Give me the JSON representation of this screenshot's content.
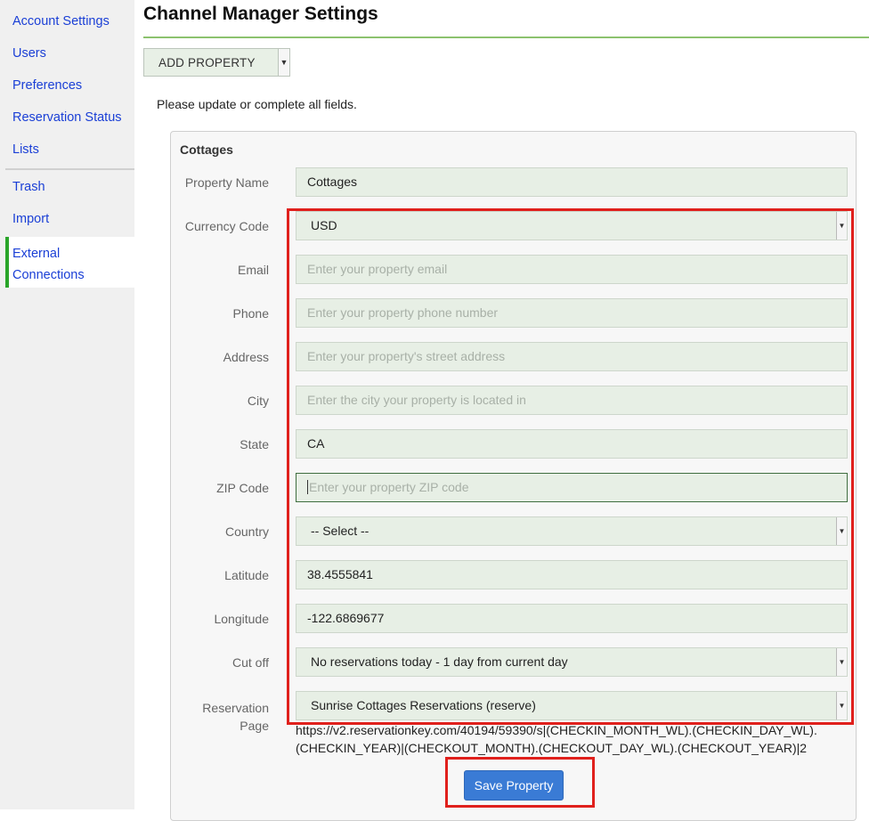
{
  "sidebar": {
    "items": [
      {
        "label": "Account Settings"
      },
      {
        "label": "Users"
      },
      {
        "label": "Preferences"
      },
      {
        "label": "Reservation Status"
      },
      {
        "label": "Lists"
      },
      {
        "label": "Trash"
      },
      {
        "label": "Import"
      },
      {
        "label": "External\nConnections",
        "active": true
      }
    ]
  },
  "header": {
    "title": "Channel Manager Settings",
    "add_property_label": "ADD PROPERTY"
  },
  "instructions": "Please update or complete all fields.",
  "form": {
    "section_title": "Cottages",
    "fields": {
      "property_name": {
        "label": "Property Name",
        "value": "Cottages"
      },
      "currency_code": {
        "label": "Currency Code",
        "value": "USD"
      },
      "email": {
        "label": "Email",
        "placeholder": "Enter your property email"
      },
      "phone": {
        "label": "Phone",
        "placeholder": "Enter your property phone number"
      },
      "address": {
        "label": "Address",
        "placeholder": "Enter your property's street address"
      },
      "city": {
        "label": "City",
        "placeholder": "Enter the city your property is located in"
      },
      "state": {
        "label": "State",
        "value": "CA"
      },
      "zip": {
        "label": "ZIP Code",
        "placeholder": "Enter your property ZIP code"
      },
      "country": {
        "label": "Country",
        "value": "-- Select --"
      },
      "latitude": {
        "label": "Latitude",
        "value": "38.4555841"
      },
      "longitude": {
        "label": "Longitude",
        "value": "-122.6869677"
      },
      "cut_off": {
        "label": "Cut off",
        "value": "No reservations today - 1 day from current day"
      },
      "reservation_page": {
        "label_line1": "Reservation",
        "label_line2": "Page",
        "value": "Sunrise Cottages Reservations (reserve)"
      }
    },
    "reservation_url": "https://v2.reservationkey.com/40194/59390/s|(CHECKIN_MONTH_WL).(CHECKIN_DAY_WL).(CHECKIN_YEAR)|(CHECKOUT_MONTH).(CHECKOUT_DAY_WL).(CHECKOUT_YEAR)|2",
    "save_label": "Save Property"
  },
  "colors": {
    "link": "#1a3fd6",
    "accent_green": "#2aa52a",
    "field_bg": "#e7efe5",
    "button_blue": "#3a7bd5",
    "highlight_red": "#e0201c"
  }
}
